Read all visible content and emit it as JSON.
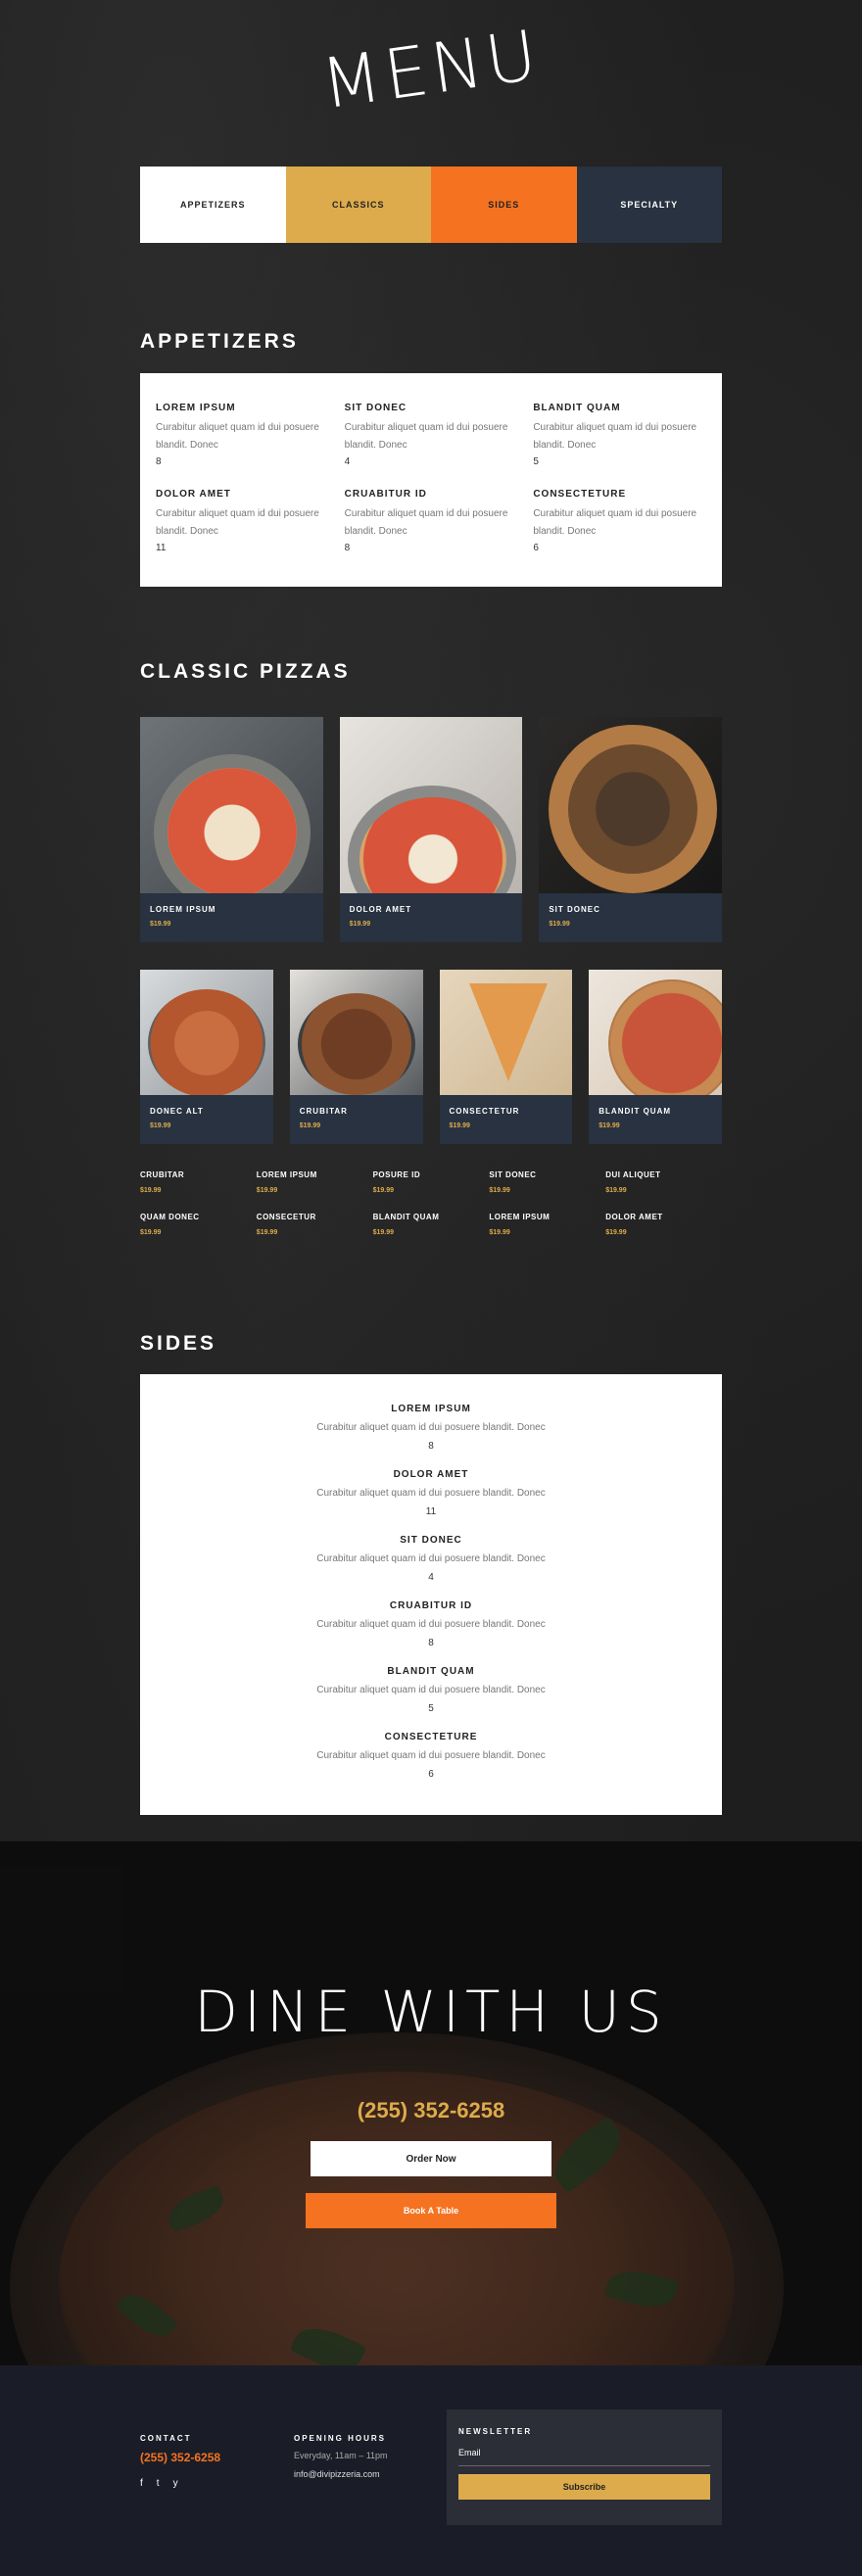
{
  "menu_title": "MENU",
  "tabs": [
    "APPETIZERS",
    "CLASSICS",
    "SIDES",
    "SPECIALTY"
  ],
  "appetizers": {
    "heading": "APPETIZERS",
    "items": [
      {
        "name": "LOREM IPSUM",
        "desc": "Curabitur aliquet quam id dui posuere blandit. Donec",
        "price": "8"
      },
      {
        "name": "SIT DONEC",
        "desc": "Curabitur aliquet quam id dui posuere blandit. Donec",
        "price": "4"
      },
      {
        "name": "BLANDIT QUAM",
        "desc": "Curabitur aliquet quam id dui posuere blandit. Donec",
        "price": "5"
      },
      {
        "name": "DOLOR AMET",
        "desc": "Curabitur aliquet quam id dui posuere blandit. Donec",
        "price": "11"
      },
      {
        "name": "CRUABITUR ID",
        "desc": "Curabitur aliquet quam id dui posuere blandit. Donec",
        "price": "8"
      },
      {
        "name": "CONSECTETURE",
        "desc": "Curabitur aliquet quam id dui posuere blandit. Donec",
        "price": "6"
      }
    ]
  },
  "classic_pizzas": {
    "heading": "CLASSIC PIZZAS",
    "row1": [
      {
        "name": "LOREM IPSUM",
        "price": "$19.99"
      },
      {
        "name": "DOLOR AMET",
        "price": "$19.99"
      },
      {
        "name": "SIT DONEC",
        "price": "$19.99"
      }
    ],
    "row2": [
      {
        "name": "DONEC ALT",
        "price": "$19.99"
      },
      {
        "name": "CRUBITAR",
        "price": "$19.99"
      },
      {
        "name": "CONSECTETUR",
        "price": "$19.99"
      },
      {
        "name": "BLANDIT QUAM",
        "price": "$19.99"
      }
    ],
    "price_list": [
      {
        "name": "CRUBITAR",
        "price": "$19.99"
      },
      {
        "name": "LOREM IPSUM",
        "price": "$19.99"
      },
      {
        "name": "POSURE ID",
        "price": "$19.99"
      },
      {
        "name": "SIT DONEC",
        "price": "$19.99"
      },
      {
        "name": "DUI ALIQUET",
        "price": "$19.99"
      },
      {
        "name": "QUAM DONEC",
        "price": "$19.99"
      },
      {
        "name": "CONSECETUR",
        "price": "$19.99"
      },
      {
        "name": "BLANDIT QUAM",
        "price": "$19.99"
      },
      {
        "name": "LOREM IPSUM",
        "price": "$19.99"
      },
      {
        "name": "DOLOR AMET",
        "price": "$19.99"
      }
    ]
  },
  "sides": {
    "heading": "SIDES",
    "items": [
      {
        "name": "LOREM IPSUM",
        "desc": "Curabitur aliquet quam id dui posuere blandit. Donec",
        "price": "8"
      },
      {
        "name": "DOLOR AMET",
        "desc": "Curabitur aliquet quam id dui posuere blandit. Donec",
        "price": "11"
      },
      {
        "name": "SIT DONEC",
        "desc": "Curabitur aliquet quam id dui posuere blandit. Donec",
        "price": "4"
      },
      {
        "name": "CRUABITUR ID",
        "desc": "Curabitur aliquet quam id dui posuere blandit. Donec",
        "price": "8"
      },
      {
        "name": "BLANDIT QUAM",
        "desc": "Curabitur aliquet quam id dui posuere blandit. Donec",
        "price": "5"
      },
      {
        "name": "CONSECTETURE",
        "desc": "Curabitur aliquet quam id dui posuere blandit. Donec",
        "price": "6"
      }
    ]
  },
  "dine": {
    "title": "DINE WITH US",
    "phone": "(255) 352-6258",
    "order_label": "Order Now",
    "book_label": "Book A Table"
  },
  "footer": {
    "contact_heading": "CONTACT",
    "contact_phone": "(255) 352-6258",
    "social": [
      "f",
      "t",
      "y"
    ],
    "hours_heading": "OPENING HOURS",
    "hours_text": "Everyday, 11am – 11pm",
    "email": "info@divipizzeria.com",
    "newsletter_heading": "NEWSLETTER",
    "newsletter_placeholder": "Email",
    "subscribe_label": "Subscribe"
  },
  "colors": {
    "gold": "#ddab4b",
    "orange": "#f57320",
    "navy": "#283240",
    "footer_bg": "#1a1d27"
  }
}
